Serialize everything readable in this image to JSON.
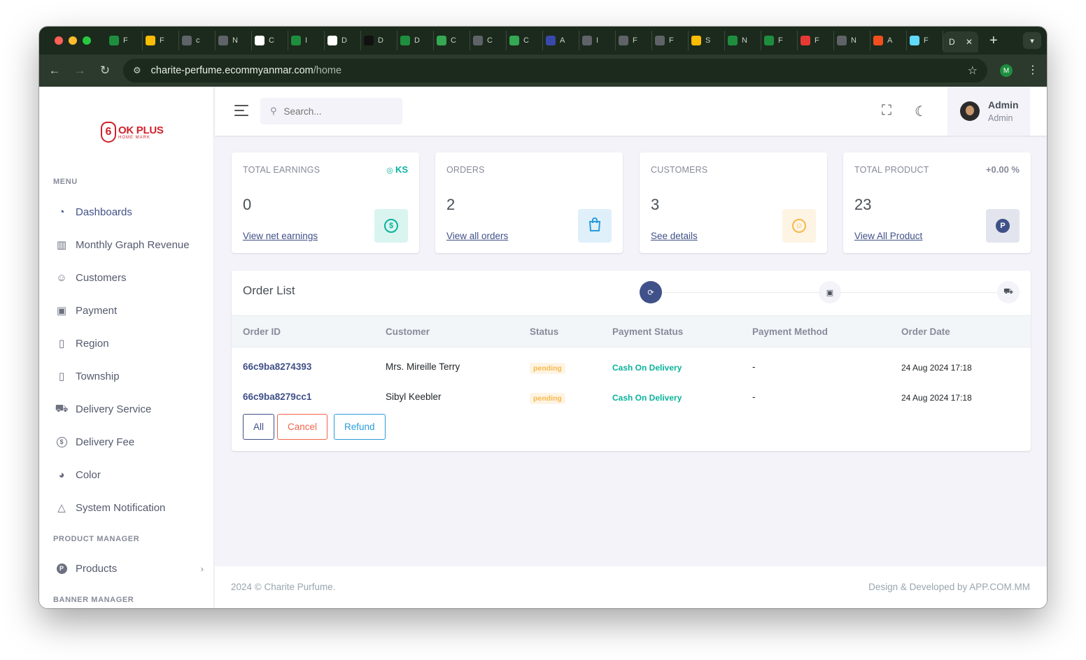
{
  "browser": {
    "tab_letters": [
      "F",
      "F",
      "c",
      "N",
      "C",
      "I",
      "D",
      "D",
      "D",
      "C",
      "C",
      "C",
      "A",
      "I",
      "F",
      "F",
      "S",
      "N",
      "F",
      "F",
      "N",
      "A",
      "F"
    ],
    "active_tab_letter": "D",
    "url_host": "charite-perfume.ecommyanmar.com",
    "url_path": "/home",
    "profile_initial": "M"
  },
  "sidebar": {
    "logo_text": "OK PLUS",
    "logo_sub": "HOME MARK",
    "menu_title": "MENU",
    "items": [
      {
        "label": "Dashboards",
        "icon": "dashboard-icon"
      },
      {
        "label": "Monthly Graph Revenue",
        "icon": "bar-chart-icon"
      },
      {
        "label": "Customers",
        "icon": "users-icon"
      },
      {
        "label": "Payment",
        "icon": "payment-icon"
      },
      {
        "label": "Region",
        "icon": "map-icon"
      },
      {
        "label": "Township",
        "icon": "map-icon"
      },
      {
        "label": "Delivery Service",
        "icon": "truck-icon"
      },
      {
        "label": "Delivery Fee",
        "icon": "dollar-circle-icon"
      },
      {
        "label": "Color",
        "icon": "palette-icon"
      },
      {
        "label": "System Notification",
        "icon": "bell-icon"
      }
    ],
    "product_title": "PRODUCT MANAGER",
    "products_label": "Products",
    "banner_title": "BANNER MANAGER"
  },
  "topbar": {
    "search_placeholder": "Search...",
    "user_name": "Admin",
    "user_role": "Admin"
  },
  "cards": [
    {
      "title": "TOTAL EARNINGS",
      "extra": "KS",
      "value": "0",
      "link": "View net earnings",
      "icon": "dollar-icon",
      "color": "#0ab39c",
      "bg": "#daf4f0"
    },
    {
      "title": "ORDERS",
      "extra": "",
      "value": "2",
      "link": "View all orders",
      "icon": "shopping-bag-icon",
      "color": "#299cdb",
      "bg": "#dff0fa"
    },
    {
      "title": "CUSTOMERS",
      "extra": "",
      "value": "3",
      "link": "See details",
      "icon": "user-circle-icon",
      "color": "#f7b84b",
      "bg": "#fef4e4"
    },
    {
      "title": "TOTAL PRODUCT",
      "extra": "+0.00 %",
      "value": "23",
      "link": "View All Product",
      "icon": "product-p-icon",
      "color": "#405189",
      "bg": "#e2e5ed"
    }
  ],
  "orders": {
    "title": "Order List",
    "columns": [
      "Order ID",
      "Customer",
      "Status",
      "Payment Status",
      "Payment Method",
      "Order Date"
    ],
    "rows": [
      {
        "id": "66c9ba8274393",
        "customer": "Mrs. Mireille Terry",
        "status": "pending",
        "payment_status": "Cash On Delivery",
        "payment_method": "-",
        "date": "24 Aug 2024 17:18"
      },
      {
        "id": "66c9ba8279cc1",
        "customer": "Sibyl Keebler",
        "status": "pending",
        "payment_status": "Cash On Delivery",
        "payment_method": "-",
        "date": "24 Aug 2024 17:18"
      }
    ],
    "filters": [
      "All",
      "Cancel",
      "Refund"
    ]
  },
  "footer": {
    "left": "2024 © Charite Purfume.",
    "right": "Design & Developed by APP.COM.MM"
  },
  "colors": {
    "primary": "#405189",
    "success": "#0ab39c",
    "warning": "#f7b84b",
    "danger": "#f06548",
    "info": "#299cdb"
  }
}
